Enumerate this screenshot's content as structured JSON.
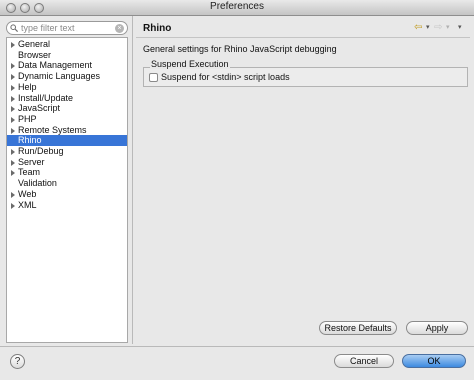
{
  "window": {
    "title": "Preferences"
  },
  "filter": {
    "placeholder": "type filter text"
  },
  "tree": {
    "items": [
      {
        "label": "General",
        "expandable": true,
        "selected": false
      },
      {
        "label": "Browser",
        "expandable": false,
        "selected": false
      },
      {
        "label": "Data Management",
        "expandable": true,
        "selected": false
      },
      {
        "label": "Dynamic Languages",
        "expandable": true,
        "selected": false
      },
      {
        "label": "Help",
        "expandable": true,
        "selected": false
      },
      {
        "label": "Install/Update",
        "expandable": true,
        "selected": false
      },
      {
        "label": "JavaScript",
        "expandable": true,
        "selected": false
      },
      {
        "label": "PHP",
        "expandable": true,
        "selected": false
      },
      {
        "label": "Remote Systems",
        "expandable": true,
        "selected": false
      },
      {
        "label": "Rhino",
        "expandable": false,
        "selected": true
      },
      {
        "label": "Run/Debug",
        "expandable": true,
        "selected": false
      },
      {
        "label": "Server",
        "expandable": true,
        "selected": false
      },
      {
        "label": "Team",
        "expandable": true,
        "selected": false
      },
      {
        "label": "Validation",
        "expandable": false,
        "selected": false
      },
      {
        "label": "Web",
        "expandable": true,
        "selected": false
      },
      {
        "label": "XML",
        "expandable": true,
        "selected": false
      }
    ]
  },
  "page": {
    "title": "Rhino",
    "description": "General settings for Rhino JavaScript debugging",
    "group_label": "Suspend Execution",
    "checkbox_label": "Suspend for <stdin> script loads",
    "checkbox_checked": false
  },
  "buttons": {
    "restore_defaults": "Restore Defaults",
    "apply": "Apply",
    "cancel": "Cancel",
    "ok": "OK",
    "help": "?"
  },
  "icons": {
    "back": "back-arrow-icon",
    "forward": "forward-arrow-icon",
    "menu": "view-menu-icon",
    "search": "search-icon",
    "help": "help-icon"
  }
}
